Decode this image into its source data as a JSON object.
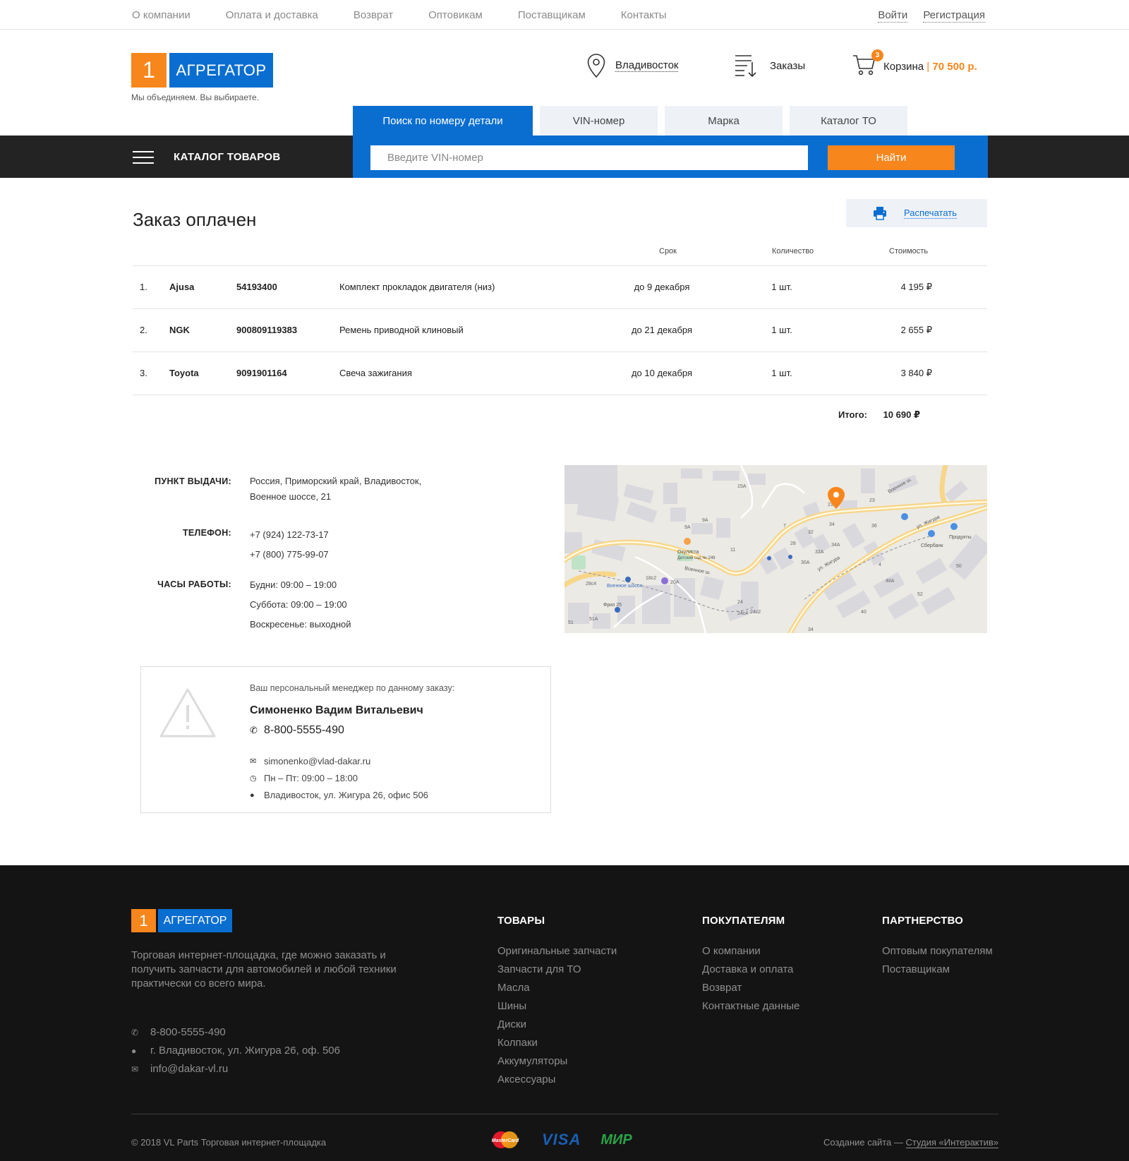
{
  "topnav": {
    "items": [
      "О компании",
      "Оплата и доставка",
      "Возврат",
      "Оптовикам",
      "Поставщикам",
      "Контакты"
    ],
    "login": "Войти",
    "register": "Регистрация"
  },
  "header": {
    "logo_num": "1",
    "logo_text": "АГРЕГАТОР",
    "tagline": "Мы объединяем. Вы выбираете.",
    "city": "Владивосток",
    "orders": "Заказы",
    "cart_label": "Корзина",
    "cart_sep": " | ",
    "cart_price": "70 500 р.",
    "cart_count": "3"
  },
  "search": {
    "tabs": [
      "Поиск по номеру детали",
      "VIN-номер",
      "Марка",
      "Каталог ТО"
    ],
    "catalog_label": "КАТАЛОГ ТОВАРОВ",
    "placeholder": "Введите VIN-номер",
    "button": "Найти"
  },
  "order": {
    "title": "Заказ оплачен",
    "print": "Распечатать",
    "columns": {
      "term": "Срок",
      "qty": "Количество",
      "cost": "Стоимость"
    },
    "rows": [
      {
        "num": "1.",
        "brand": "Ajusa",
        "code": "54193400",
        "name": "Комплект прокладок двигателя (низ)",
        "term": "до 9 декабря",
        "qty": "1 шт.",
        "cost": "4 195 ₽"
      },
      {
        "num": "2.",
        "brand": "NGK",
        "code": "900809119383",
        "name": "Ремень приводной клиновый",
        "term": "до 21 декабря",
        "qty": "1 шт.",
        "cost": "2 655 ₽"
      },
      {
        "num": "3.",
        "brand": "Toyota",
        "code": "9091901164",
        "name": "Свеча зажигания",
        "term": "до 10 декабря",
        "qty": "1 шт.",
        "cost": "3 840 ₽"
      }
    ],
    "total_label": "Итого:",
    "total_value": "10 690 ₽"
  },
  "pickup": {
    "point_label": "ПУНКТ ВЫДАЧИ:",
    "address_1": "Россия, Приморский край, Владивосток,",
    "address_2": "Военное шоссе, 21",
    "phone_label": "ТЕЛЕФОН:",
    "phone_1": "+7 (924) 122-73-17",
    "phone_2": "+7 (800) 775-99-07",
    "hours_label": "ЧАСЫ РАБОТЫ:",
    "hours_1": "Будни: 09:00 – 19:00",
    "hours_2": "Суббота: 09:00 – 19:00",
    "hours_3": "Воскресенье: выходной"
  },
  "manager": {
    "caption": "Ваш персональный менеджер по данному заказу:",
    "name": "Симоненко Вадим Витальевич",
    "phone": "8-800-5555-490",
    "email": "simonenko@vlad-dakar.ru",
    "hours": "Пн – Пт: 09:00 – 18:00",
    "address": "Владивосток, ул. Жигура 26, офис 506"
  },
  "footer": {
    "logo_num": "1",
    "logo_text": "АГРЕГАТОР",
    "description": "Торговая интернет-площадка, где можно заказать и получить запчасти для автомобилей и любой техники практически со всего мира.",
    "phone": "8-800-5555-490",
    "address": "г. Владивосток, ул. Жигура 26, оф. 506",
    "email": "info@dakar-vl.ru",
    "col_goods": {
      "title": "ТОВАРЫ",
      "items": [
        "Оригинальные запчасти",
        "Запчасти для ТО",
        "Масла",
        "Шины",
        "Диски",
        "Колпаки",
        "Аккумуляторы",
        "Аксессуары"
      ]
    },
    "col_buyers": {
      "title": "ПОКУПАТЕЛЯМ",
      "items": [
        "О компании",
        "Доставка и оплата",
        "Возврат",
        "Контактные данные"
      ]
    },
    "col_partners": {
      "title": "ПАРТНЕРСТВО",
      "items": [
        "Оптовым покупателям",
        "Поставщикам"
      ]
    },
    "copyright": "© 2018 VL Parts Торговая интернет-площадка",
    "made_prefix": "Создание сайта — ",
    "made_link": "Студия «Интерактив»",
    "pay_visa": "VISA",
    "pay_mir": "МИР",
    "pay_mc": "MasterCard"
  },
  "map": {
    "labels": [
      "Военное ш.",
      "ул. Жигура",
      "Военное шоссе",
      "Окулиста",
      "Детский сад № 249",
      "Сбербанк",
      "Продукты",
      "Фриз 25"
    ],
    "numbers": [
      "15А",
      "21",
      "23",
      "32",
      "34",
      "34А",
      "36",
      "30А",
      "32А",
      "28",
      "24",
      "24с2",
      "24с4",
      "20А",
      "18с2",
      "9А",
      "9А",
      "11",
      "7",
      "48А",
      "52",
      "40",
      "50",
      "4",
      "51",
      "51А",
      "28с4",
      "34"
    ]
  },
  "colors": {
    "accent": "#f7861c",
    "brand_blue": "#0a6ed1",
    "dark": "#232323",
    "footer_bg": "#141414"
  }
}
